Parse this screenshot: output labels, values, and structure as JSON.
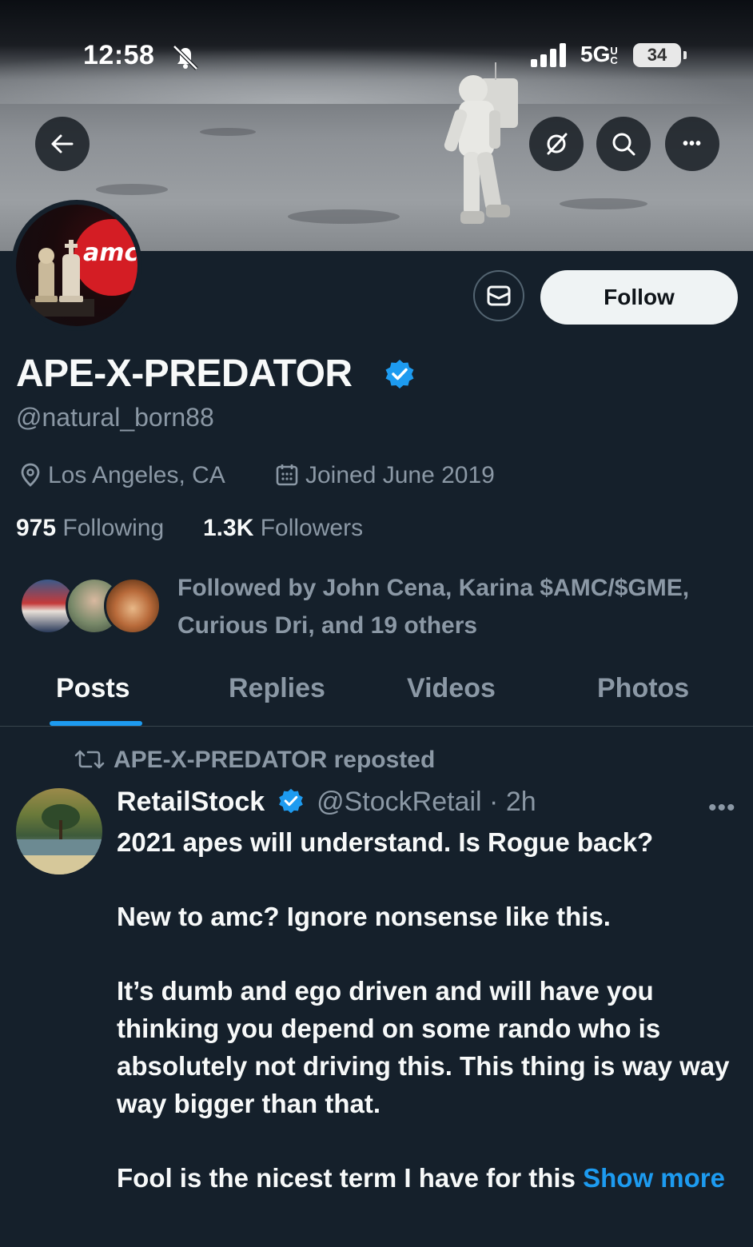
{
  "status_bar": {
    "time": "12:58",
    "network": "5G",
    "network_sub": "UC",
    "battery": "34",
    "icons": [
      "bell-slash-icon",
      "signal-icon"
    ]
  },
  "header_actions": {
    "back": "back-arrow-icon",
    "grok": "grok-icon",
    "search": "search-icon",
    "more": "more-icon",
    "more_label": "•••"
  },
  "avatar": {
    "logo_text": "amc"
  },
  "profile": {
    "display_name": "APE-X-PREDATOR",
    "handle": "@natural_born88",
    "location": "Los Angeles, CA",
    "joined": "Joined June 2019",
    "following_count": "975",
    "following_label": "Following",
    "followers_count": "1.3K",
    "followers_label": "Followers",
    "followed_by": "Followed by John Cena, Karina $AMC/$GME, Curious Dri, and 19 others",
    "follow_button": "Follow",
    "verified_color": "#1d9bf0"
  },
  "tabs": [
    {
      "label": "Posts",
      "active": true
    },
    {
      "label": "Replies",
      "active": false
    },
    {
      "label": "Videos",
      "active": false
    },
    {
      "label": "Photos",
      "active": false
    }
  ],
  "post": {
    "repost_label": "APE-X-PREDATOR reposted",
    "author": "RetailStock",
    "handle": "@StockRetail",
    "separator": "·",
    "time": "2h",
    "more_label": "•••",
    "paragraphs": [
      "2021 apes will understand. Is Rogue back?",
      "New to amc? Ignore nonsense like this.",
      "It’s dumb and ego driven and will have you thinking you depend on some rando who is absolutely not driving this. This thing is way way way bigger than that.",
      "Fool is the nicest term I have for this"
    ],
    "show_more": "Show more"
  },
  "colors": {
    "background": "#15202b",
    "accent": "#1d9bf0",
    "secondary_text": "#8b98a5",
    "amc_red": "#d41d24"
  }
}
